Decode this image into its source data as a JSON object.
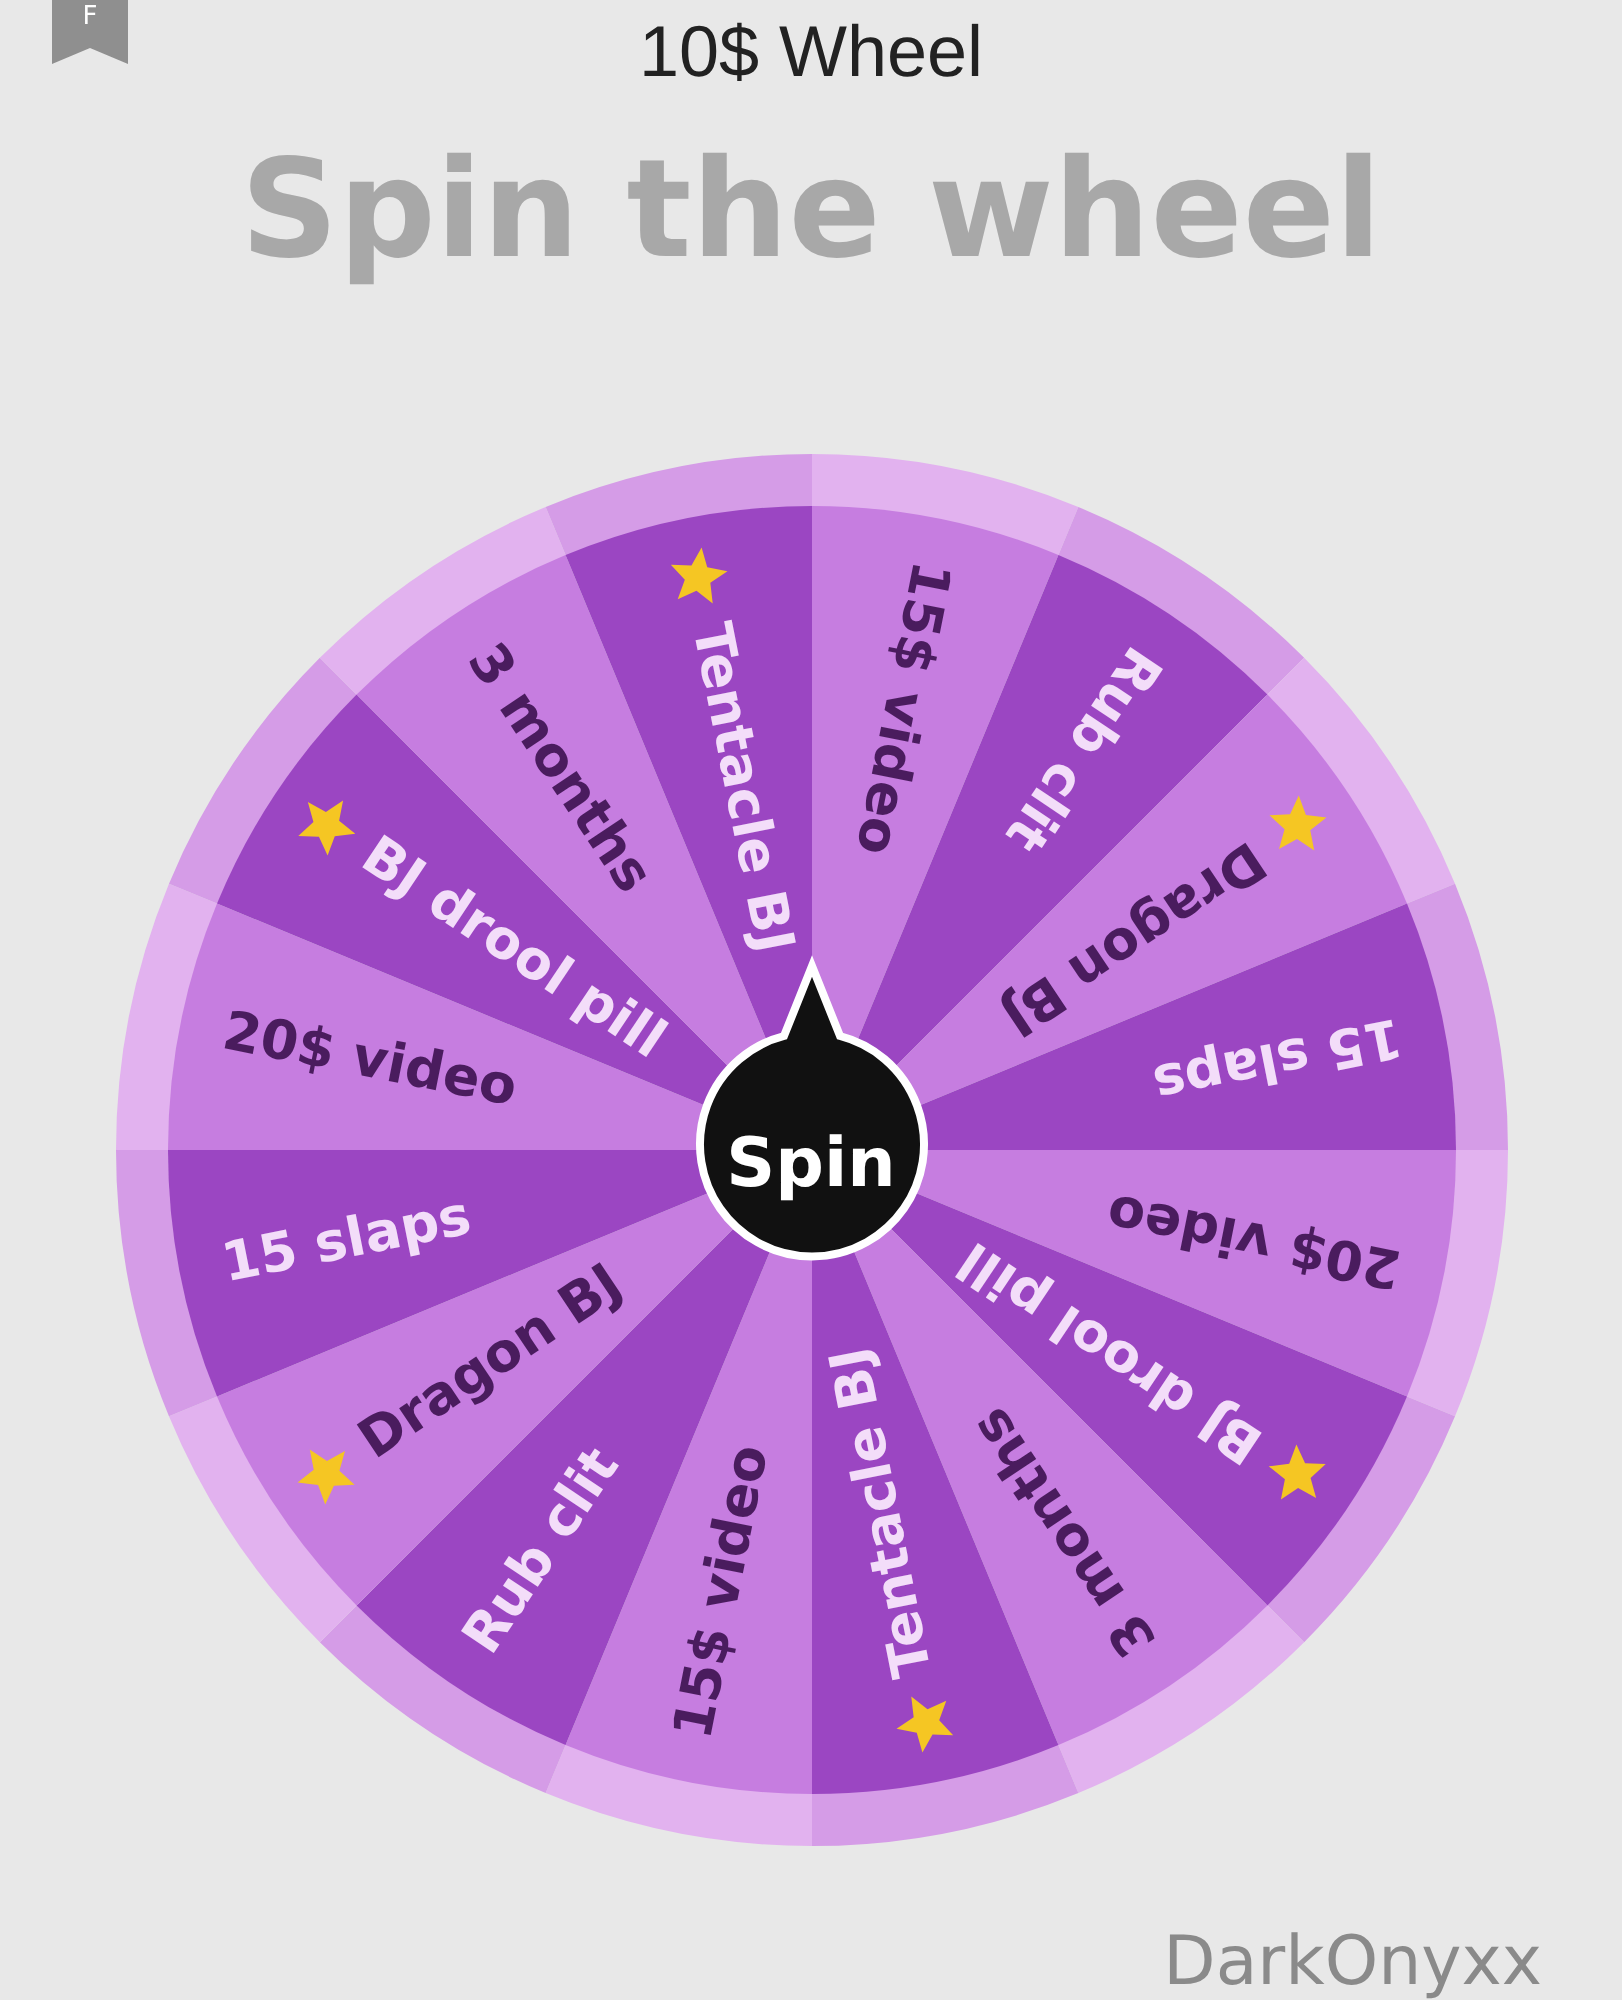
{
  "header": {
    "bookmark_letter": "F",
    "title": "10$ Wheel"
  },
  "heading": "Spin the wheel",
  "wheel": {
    "button": "Spin",
    "segments": [
      {
        "label": "15$ video",
        "starred": false
      },
      {
        "label": "Rub clit",
        "starred": false
      },
      {
        "label": "Dragon BJ",
        "starred": true
      },
      {
        "label": "15 slaps",
        "starred": false
      },
      {
        "label": "20$ video",
        "starred": false
      },
      {
        "label": "BJ drool pill",
        "starred": true
      },
      {
        "label": "3 months",
        "starred": false
      },
      {
        "label": "Tentacle BJ",
        "starred": true
      },
      {
        "label": "15$ video",
        "starred": false
      },
      {
        "label": "Rub clit",
        "starred": false
      },
      {
        "label": "Dragon BJ",
        "starred": true
      },
      {
        "label": "15 slaps",
        "starred": false
      },
      {
        "label": "20$ video",
        "starred": false
      },
      {
        "label": "BJ drool pill",
        "starred": true
      },
      {
        "label": "3 months",
        "starred": false
      },
      {
        "label": "Tentacle BJ",
        "starred": true
      }
    ]
  },
  "footer": "DarkOnyxx"
}
